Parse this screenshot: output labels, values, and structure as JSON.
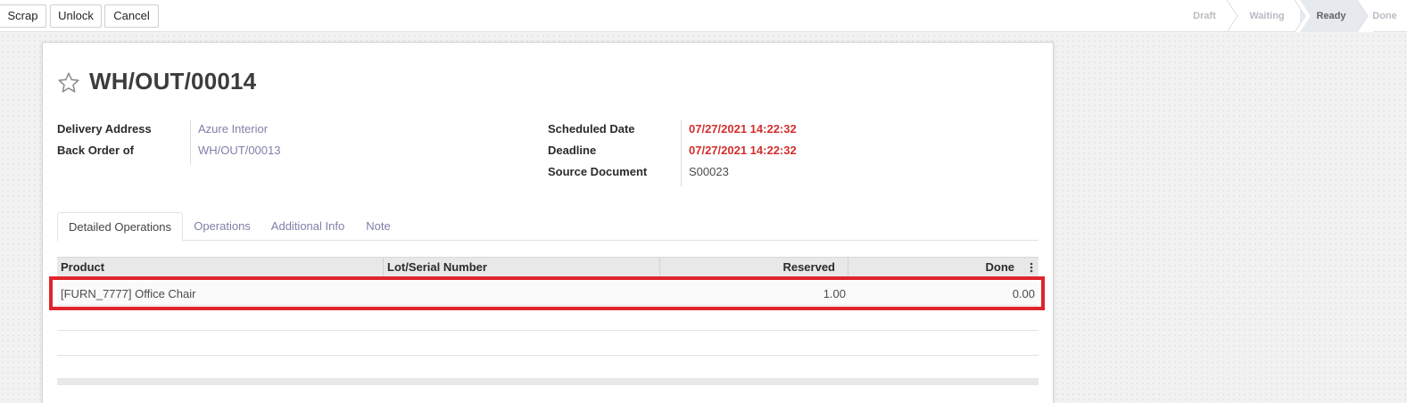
{
  "control_bar": {
    "buttons": [
      {
        "label": "Scrap"
      },
      {
        "label": "Unlock"
      },
      {
        "label": "Cancel"
      }
    ]
  },
  "statusbar": {
    "stages": [
      "Draft",
      "Waiting",
      "Ready",
      "Done"
    ],
    "active": "Ready"
  },
  "record": {
    "title": "WH/OUT/00014",
    "fields_left": [
      {
        "label": "Delivery Address",
        "value": "Azure Interior"
      },
      {
        "label": "Back Order of",
        "value": "WH/OUT/00013"
      }
    ],
    "fields_right": [
      {
        "label": "Scheduled Date",
        "value": "07/27/2021 14:22:32"
      },
      {
        "label": "Deadline",
        "value": "07/27/2021 14:22:32"
      },
      {
        "label": "Source Document",
        "value": "S00023"
      }
    ]
  },
  "tabs": [
    "Detailed Operations",
    "Operations",
    "Additional Info",
    "Note"
  ],
  "table": {
    "columns": [
      "Product",
      "Lot/Serial Number",
      "Reserved",
      "Done"
    ],
    "rows": [
      {
        "product": "[FURN_7777] Office Chair",
        "lot": "",
        "reserved": "1.00",
        "done": "0.00"
      }
    ]
  },
  "colors": {
    "accent_link": "#7f7fa9",
    "deadline_red": "#d32f2f",
    "highlight_red": "#e0242c"
  }
}
